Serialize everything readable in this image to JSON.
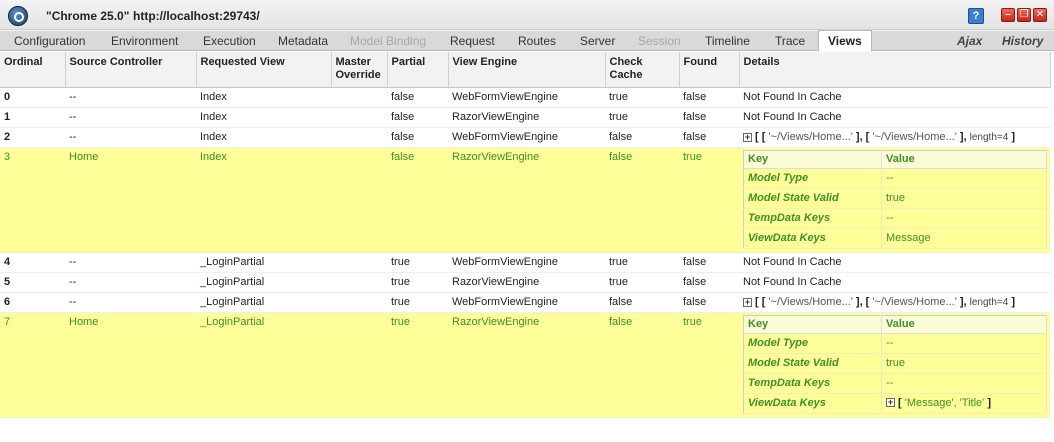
{
  "window": {
    "name": "\"Chrome 25.0\"",
    "url": "http://localhost:29743/",
    "help": "?"
  },
  "tabs": [
    {
      "label": "Configuration"
    },
    {
      "label": "Environment"
    },
    {
      "label": "Execution"
    },
    {
      "label": "Metadata"
    },
    {
      "label": "Model Binding",
      "disabled": true
    },
    {
      "label": "Request"
    },
    {
      "label": "Routes"
    },
    {
      "label": "Server"
    },
    {
      "label": "Session",
      "disabled": true
    },
    {
      "label": "Timeline"
    },
    {
      "label": "Trace"
    },
    {
      "label": "Views",
      "active": true
    }
  ],
  "right_tabs": [
    {
      "label": "Ajax"
    },
    {
      "label": "History"
    }
  ],
  "columns": [
    "Ordinal",
    "Source Controller",
    "Requested View",
    "Master Override",
    "Partial",
    "View Engine",
    "Check Cache",
    "Found",
    "Details"
  ],
  "sub_columns": [
    "Key",
    "Value"
  ],
  "rows": [
    {
      "ordinal": "0",
      "controller": "--",
      "view": "Index",
      "master": "",
      "partial": "false",
      "engine": "WebFormViewEngine",
      "check": "true",
      "found": "false",
      "detail": "Not Found In Cache"
    },
    {
      "ordinal": "1",
      "controller": "--",
      "view": "Index",
      "master": "",
      "partial": "false",
      "engine": "RazorViewEngine",
      "check": "true",
      "found": "false",
      "detail": "Not Found In Cache"
    },
    {
      "ordinal": "2",
      "controller": "--",
      "view": "Index",
      "master": "",
      "partial": "false",
      "engine": "WebFormViewEngine",
      "check": "false",
      "found": "false",
      "detail_array": {
        "first": "'~/Views/Home...'",
        "second": "'~/Views/Home...'",
        "length": "length=4"
      }
    },
    {
      "ordinal": "3",
      "controller": "Home",
      "view": "Index",
      "master": "",
      "partial": "false",
      "engine": "RazorViewEngine",
      "check": "false",
      "found": "true",
      "highlight": true,
      "sub": [
        {
          "key": "Model Type",
          "value": "--"
        },
        {
          "key": "Model State Valid",
          "value": "true"
        },
        {
          "key": "TempData Keys",
          "value": "--"
        },
        {
          "key": "ViewData Keys",
          "value": "Message"
        }
      ]
    },
    {
      "ordinal": "4",
      "controller": "--",
      "view": "_LoginPartial",
      "master": "",
      "partial": "true",
      "engine": "WebFormViewEngine",
      "check": "true",
      "found": "false",
      "detail": "Not Found In Cache"
    },
    {
      "ordinal": "5",
      "controller": "--",
      "view": "_LoginPartial",
      "master": "",
      "partial": "true",
      "engine": "RazorViewEngine",
      "check": "true",
      "found": "false",
      "detail": "Not Found In Cache"
    },
    {
      "ordinal": "6",
      "controller": "--",
      "view": "_LoginPartial",
      "master": "",
      "partial": "true",
      "engine": "WebFormViewEngine",
      "check": "false",
      "found": "false",
      "detail_array": {
        "first": "'~/Views/Home...'",
        "second": "'~/Views/Home...'",
        "length": "length=4"
      }
    },
    {
      "ordinal": "7",
      "controller": "Home",
      "view": "_LoginPartial",
      "master": "",
      "partial": "true",
      "engine": "RazorViewEngine",
      "check": "false",
      "found": "true",
      "highlight": true,
      "sub": [
        {
          "key": "Model Type",
          "value": "--"
        },
        {
          "key": "Model State Valid",
          "value": "true"
        },
        {
          "key": "TempData Keys",
          "value": "--"
        },
        {
          "key": "ViewData Keys",
          "value_array": "'Message', 'Title'"
        }
      ]
    }
  ],
  "colors": {
    "highlight": "#ffff99",
    "highlight_text": "#3f8f2a",
    "tabbar": "#d9d9d9"
  }
}
